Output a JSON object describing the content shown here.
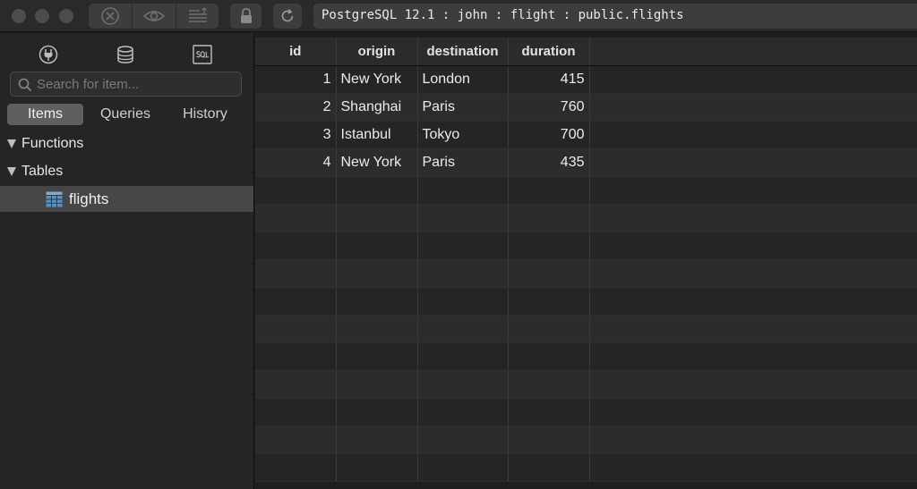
{
  "toolbar": {
    "connection_info": "PostgreSQL 12.1 : john : flight : public.flights"
  },
  "sidebar": {
    "search_placeholder": "Search for item...",
    "tabs": [
      {
        "label": "Items",
        "active": true
      },
      {
        "label": "Queries",
        "active": false
      },
      {
        "label": "History",
        "active": false
      }
    ],
    "tree": {
      "functions_label": "Functions",
      "tables_label": "Tables",
      "table_items": [
        {
          "label": "flights",
          "selected": true
        }
      ]
    }
  },
  "grid": {
    "columns": [
      "id",
      "origin",
      "destination",
      "duration"
    ],
    "rows": [
      [
        "1",
        "New York",
        "London",
        "415"
      ],
      [
        "2",
        "Shanghai",
        "Paris",
        "760"
      ],
      [
        "3",
        "Istanbul",
        "Tokyo",
        "700"
      ],
      [
        "4",
        "New York",
        "Paris",
        "435"
      ]
    ]
  },
  "colors": {
    "window_bg": "#1e1e1e",
    "sidebar_bg": "#252525",
    "selected_item_bg": "#464646",
    "table_icon": "#5b8fbf"
  }
}
